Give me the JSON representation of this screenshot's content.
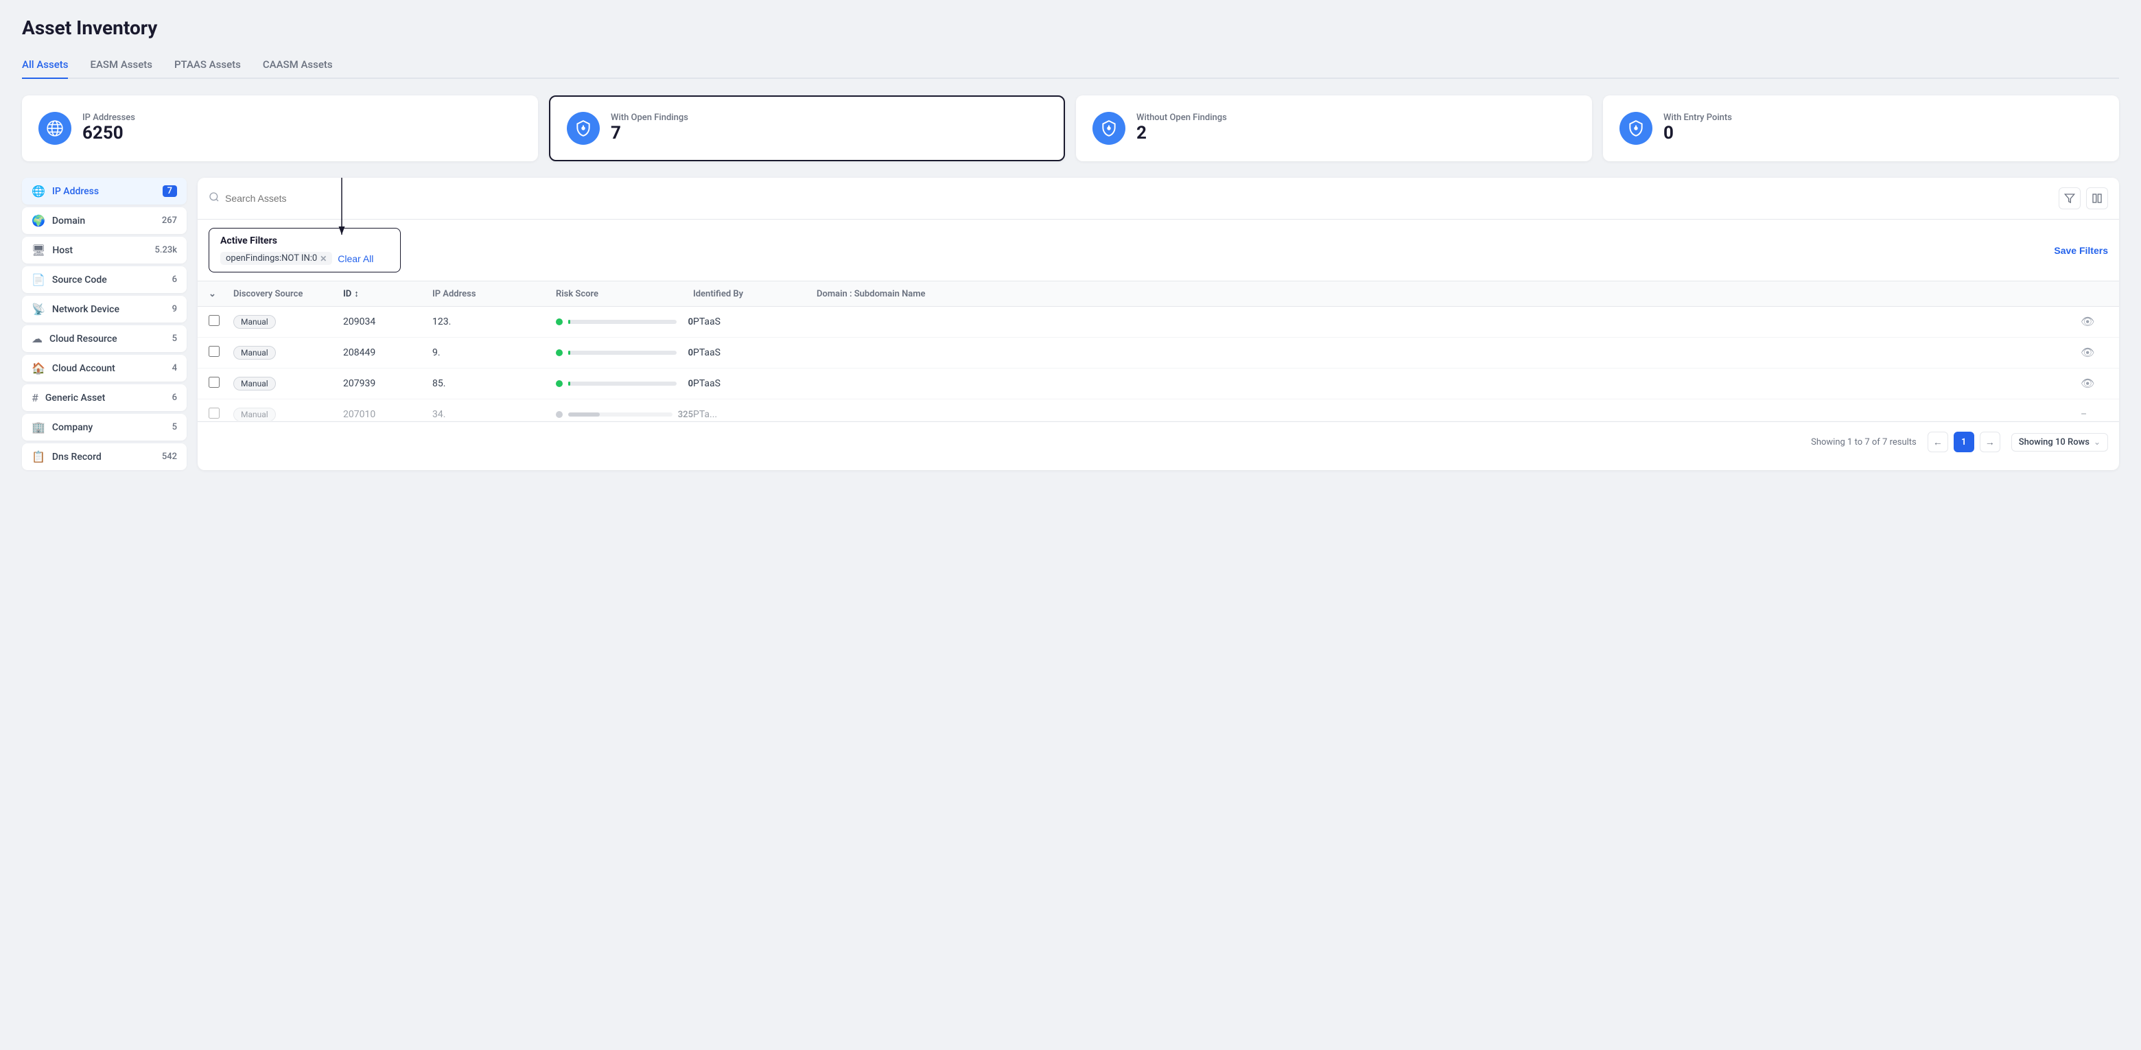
{
  "page": {
    "title": "Asset Inventory"
  },
  "tabs": [
    {
      "label": "All Assets",
      "active": true
    },
    {
      "label": "EASM Assets",
      "active": false
    },
    {
      "label": "PTAAS Assets",
      "active": false
    },
    {
      "label": "CAASM Assets",
      "active": false
    }
  ],
  "stats": [
    {
      "icon": "globe",
      "label": "IP Addresses",
      "value": "6250",
      "selected": false
    },
    {
      "icon": "shield",
      "label": "With Open Findings",
      "value": "7",
      "selected": true
    },
    {
      "icon": "shield",
      "label": "Without Open Findings",
      "value": "2",
      "selected": false
    },
    {
      "icon": "shield",
      "label": "With Entry Points",
      "value": "0",
      "selected": false
    }
  ],
  "sidebar": {
    "items": [
      {
        "icon": "🌐",
        "label": "IP Address",
        "count": "7",
        "active": true
      },
      {
        "icon": "🌍",
        "label": "Domain",
        "count": "267",
        "active": false
      },
      {
        "icon": "🖥",
        "label": "Host",
        "count": "5.23k",
        "active": false
      },
      {
        "icon": "📄",
        "label": "Source Code",
        "count": "6",
        "active": false
      },
      {
        "icon": "📡",
        "label": "Network Device",
        "count": "9",
        "active": false
      },
      {
        "icon": "☁",
        "label": "Cloud Resource",
        "count": "5",
        "active": false
      },
      {
        "icon": "🏠",
        "label": "Cloud Account",
        "count": "4",
        "active": false
      },
      {
        "icon": "#",
        "label": "Generic Asset",
        "count": "6",
        "active": false
      },
      {
        "icon": "🏢",
        "label": "Company",
        "count": "5",
        "active": false
      },
      {
        "icon": "📋",
        "label": "Dns Record",
        "count": "542",
        "active": false
      }
    ]
  },
  "search": {
    "placeholder": "Search Assets"
  },
  "filters": {
    "title": "Active Filters",
    "tags": [
      {
        "text": "openFindings:NOT IN:0"
      }
    ],
    "clear_label": "Clear All",
    "save_label": "Save Filters"
  },
  "table": {
    "columns": [
      {
        "label": ""
      },
      {
        "label": "Discovery Source"
      },
      {
        "label": "ID",
        "sortable": true
      },
      {
        "label": "IP Address"
      },
      {
        "label": "Risk Score"
      },
      {
        "label": "Identified By"
      },
      {
        "label": "Domain : Subdomain Name"
      },
      {
        "label": ""
      }
    ],
    "rows": [
      {
        "discovery_source": "Manual",
        "id": "209034",
        "ip_address": "123.",
        "risk_score": 0,
        "identified_by": "PTaaS",
        "domain": ""
      },
      {
        "discovery_source": "Manual",
        "id": "208449",
        "ip_address": "9.",
        "risk_score": 0,
        "identified_by": "PTaaS",
        "domain": ""
      },
      {
        "discovery_source": "Manual",
        "id": "207939",
        "ip_address": "85.",
        "risk_score": 0,
        "identified_by": "PTaaS",
        "domain": ""
      },
      {
        "discovery_source": "Manual",
        "id": "207010",
        "ip_address": "34.",
        "risk_score": 325,
        "identified_by": "PTa...",
        "domain": ""
      }
    ]
  },
  "pagination": {
    "current_page": 1,
    "total_info": "Showing 1 to 7 of 7 results",
    "rows_label": "Showing 10 Rows"
  }
}
